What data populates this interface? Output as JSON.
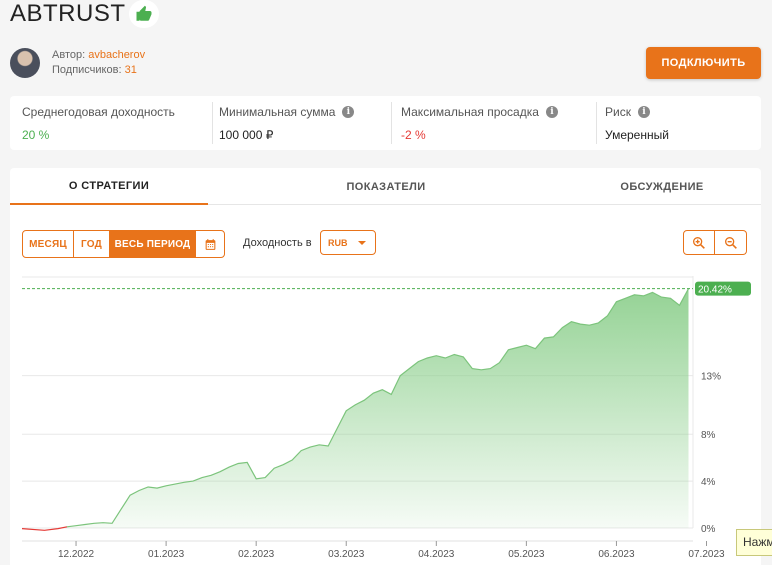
{
  "strategy": {
    "title": "ABTRUST"
  },
  "author": {
    "author_label": "Автор:",
    "author_name": "avbacherov",
    "subs_label": "Подписчиков:",
    "subs_count": "31"
  },
  "actions": {
    "connect_label": "ПОДКЛЮЧИТЬ"
  },
  "stats": {
    "annual_label": "Среднегодовая доходность",
    "annual_value": "20 %",
    "min_label": "Минимальная сумма",
    "min_value": "100 000 ₽",
    "dd_label": "Максимальная просадка",
    "dd_value": "-2 %",
    "risk_label": "Риск",
    "risk_value": "Умеренный"
  },
  "tabs": {
    "t1": "О СТРАТЕГИИ",
    "t2": "ПОКАЗАТЕЛИ",
    "t3": "ОБСУЖДЕНИЕ"
  },
  "controls": {
    "month": "МЕСЯЦ",
    "year": "ГОД",
    "all": "ВЕСЬ ПЕРИОД",
    "currency_label": "Доходность в",
    "currency": "RUB"
  },
  "tooltip": {
    "text": "Нажм"
  },
  "colors": {
    "accent": "#e8731a",
    "positive": "#4caf50",
    "negative": "#e53935",
    "area": "#8fd08f"
  },
  "chart_data": {
    "type": "area",
    "x_tick_labels": [
      "12.2022",
      "01.2023",
      "02.2023",
      "03.2023",
      "04.2023",
      "05.2023",
      "06.2023",
      "07.2023"
    ],
    "y_tick_labels": [
      "0%",
      "4%",
      "8%",
      "13%"
    ],
    "y_ticks": [
      0,
      4,
      8,
      13
    ],
    "ylim": [
      0,
      21.5
    ],
    "xlim": [
      0,
      7.45
    ],
    "current_value_label": "20.42%",
    "current_value": 20.42,
    "grid": true,
    "series": [
      {
        "x": [
          0,
          0.25,
          0.4,
          0.5,
          0.6,
          0.7,
          0.8,
          0.9,
          1.0,
          1.1,
          1.2,
          1.3,
          1.4,
          1.5,
          1.6,
          1.8,
          1.9,
          2.0,
          2.1,
          2.2,
          2.3,
          2.4,
          2.5,
          2.6,
          2.7,
          2.8,
          2.9,
          3.0,
          3.1,
          3.2,
          3.3,
          3.4,
          3.5,
          3.6,
          3.7,
          3.8,
          3.9,
          4.0,
          4.1,
          4.2,
          4.3,
          4.4,
          4.5,
          4.6,
          4.7,
          4.8,
          4.9,
          5.0,
          5.1,
          5.2,
          5.3,
          5.4,
          5.5,
          5.6,
          5.7,
          5.8,
          5.9,
          6.0,
          6.1,
          6.2,
          6.3,
          6.4,
          6.5,
          6.6,
          6.7,
          6.8,
          6.9,
          7.0,
          7.1,
          7.2,
          7.3,
          7.4
        ],
        "values": [
          -0.05,
          -0.2,
          -0.05,
          0.1,
          0.2,
          0.3,
          0.4,
          0.45,
          0.4,
          1.6,
          2.8,
          3.2,
          3.5,
          3.4,
          3.6,
          3.9,
          4.0,
          4.3,
          4.5,
          4.8,
          5.2,
          5.5,
          5.6,
          4.2,
          4.3,
          5.1,
          5.4,
          5.8,
          6.6,
          6.9,
          7.1,
          7.0,
          8.5,
          10.0,
          10.5,
          10.9,
          11.5,
          11.8,
          11.4,
          13.0,
          13.6,
          14.2,
          14.5,
          14.7,
          14.5,
          14.8,
          14.6,
          13.6,
          13.5,
          13.6,
          14.1,
          15.2,
          15.4,
          15.6,
          15.3,
          16.2,
          16.3,
          17.1,
          17.6,
          17.4,
          17.3,
          17.5,
          18.1,
          19.3,
          19.6,
          19.9,
          19.8,
          20.1,
          19.7,
          19.6,
          19.0,
          20.42
        ]
      }
    ]
  }
}
